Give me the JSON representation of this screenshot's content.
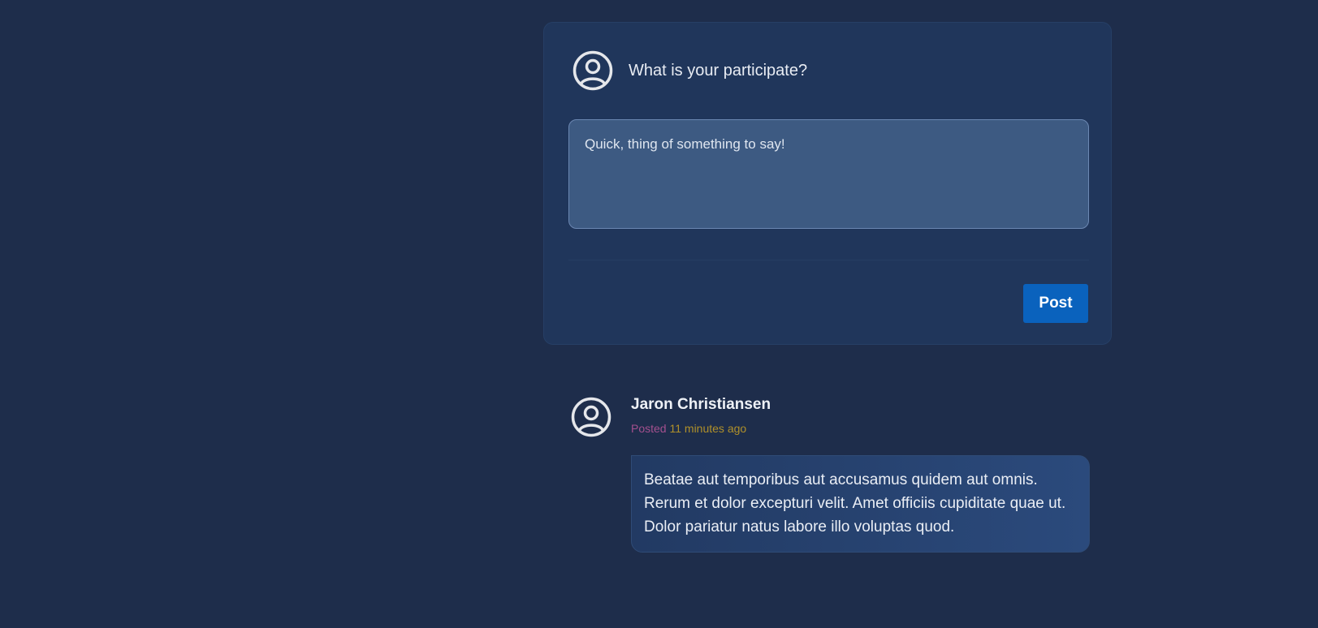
{
  "composer": {
    "title": "What is your participate?",
    "avatar_icon": "user-circle-icon",
    "textarea_placeholder": "Quick, thing of something to say!",
    "textarea_value": "",
    "post_label": "Post"
  },
  "comments": [
    {
      "author": "Jaron Christiansen",
      "avatar_icon": "user-circle-icon",
      "posted_label": "Posted",
      "time_ago": "11 minutes ago",
      "body": "Beatae aut temporibus aut accusamus quidem aut omnis. Rerum et dolor excepturi velit. Amet officiis cupiditate quae ut. Dolor pariatur natus labore illo voluptas quod."
    }
  ],
  "colors": {
    "background": "#1e2d4b",
    "card": "#20365b",
    "textarea": "#3d5a82",
    "button": "#0a62bd",
    "posted_label": "#a3508e",
    "time_ago": "#b0902a"
  }
}
